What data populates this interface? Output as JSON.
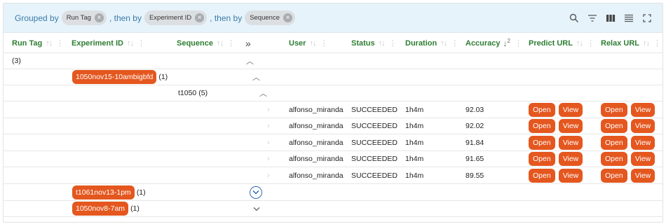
{
  "grouping": {
    "prefix": "Grouped by",
    "then1": ", then by",
    "then2": ", then by",
    "chips": [
      {
        "label": "Run Tag"
      },
      {
        "label": "Experiment ID"
      },
      {
        "label": "Sequence"
      }
    ]
  },
  "toolbar": {
    "icons": [
      "search-icon",
      "filter-icon",
      "columns-icon",
      "density-icon",
      "fullscreen-icon"
    ]
  },
  "columns": {
    "run_tag": "Run Tag",
    "experiment_id": "Experiment ID",
    "sequence": "Sequence",
    "expand_all": "»",
    "user": "User",
    "status": "Status",
    "duration": "Duration",
    "accuracy": "Accuracy",
    "accuracy_sort_rank": "2",
    "predict_url": "Predict URL",
    "relax_url": "Relax URL"
  },
  "groups": {
    "run_tag": {
      "label": "",
      "count": "(3)"
    },
    "experiment_1": {
      "label": "1050nov15-10ambigbfd",
      "count": "(1)"
    },
    "sequence_1": {
      "label": "t1050",
      "count": "(5)"
    },
    "experiment_2": {
      "label": "t1061nov13-1pm",
      "count": "(1)"
    },
    "experiment_3": {
      "label": "1050nov8-7am",
      "count": "(1)"
    }
  },
  "buttons": {
    "open": "Open",
    "view": "View"
  },
  "rows": [
    {
      "user": "alfonso_miranda",
      "status": "SUCCEEDED",
      "duration": "1h4m",
      "accuracy": "92.03"
    },
    {
      "user": "alfonso_miranda",
      "status": "SUCCEEDED",
      "duration": "1h4m",
      "accuracy": "92.02"
    },
    {
      "user": "alfonso_miranda",
      "status": "SUCCEEDED",
      "duration": "1h4m",
      "accuracy": "91.84"
    },
    {
      "user": "alfonso_miranda",
      "status": "SUCCEEDED",
      "duration": "1h4m",
      "accuracy": "91.65"
    },
    {
      "user": "alfonso_miranda",
      "status": "SUCCEEDED",
      "duration": "1h4m",
      "accuracy": "89.55"
    }
  ],
  "colors": {
    "accent": "#e4571f",
    "header_text": "#2e7d32",
    "group_bar": "#e6f3fb",
    "link_blue": "#2f6fb0"
  }
}
